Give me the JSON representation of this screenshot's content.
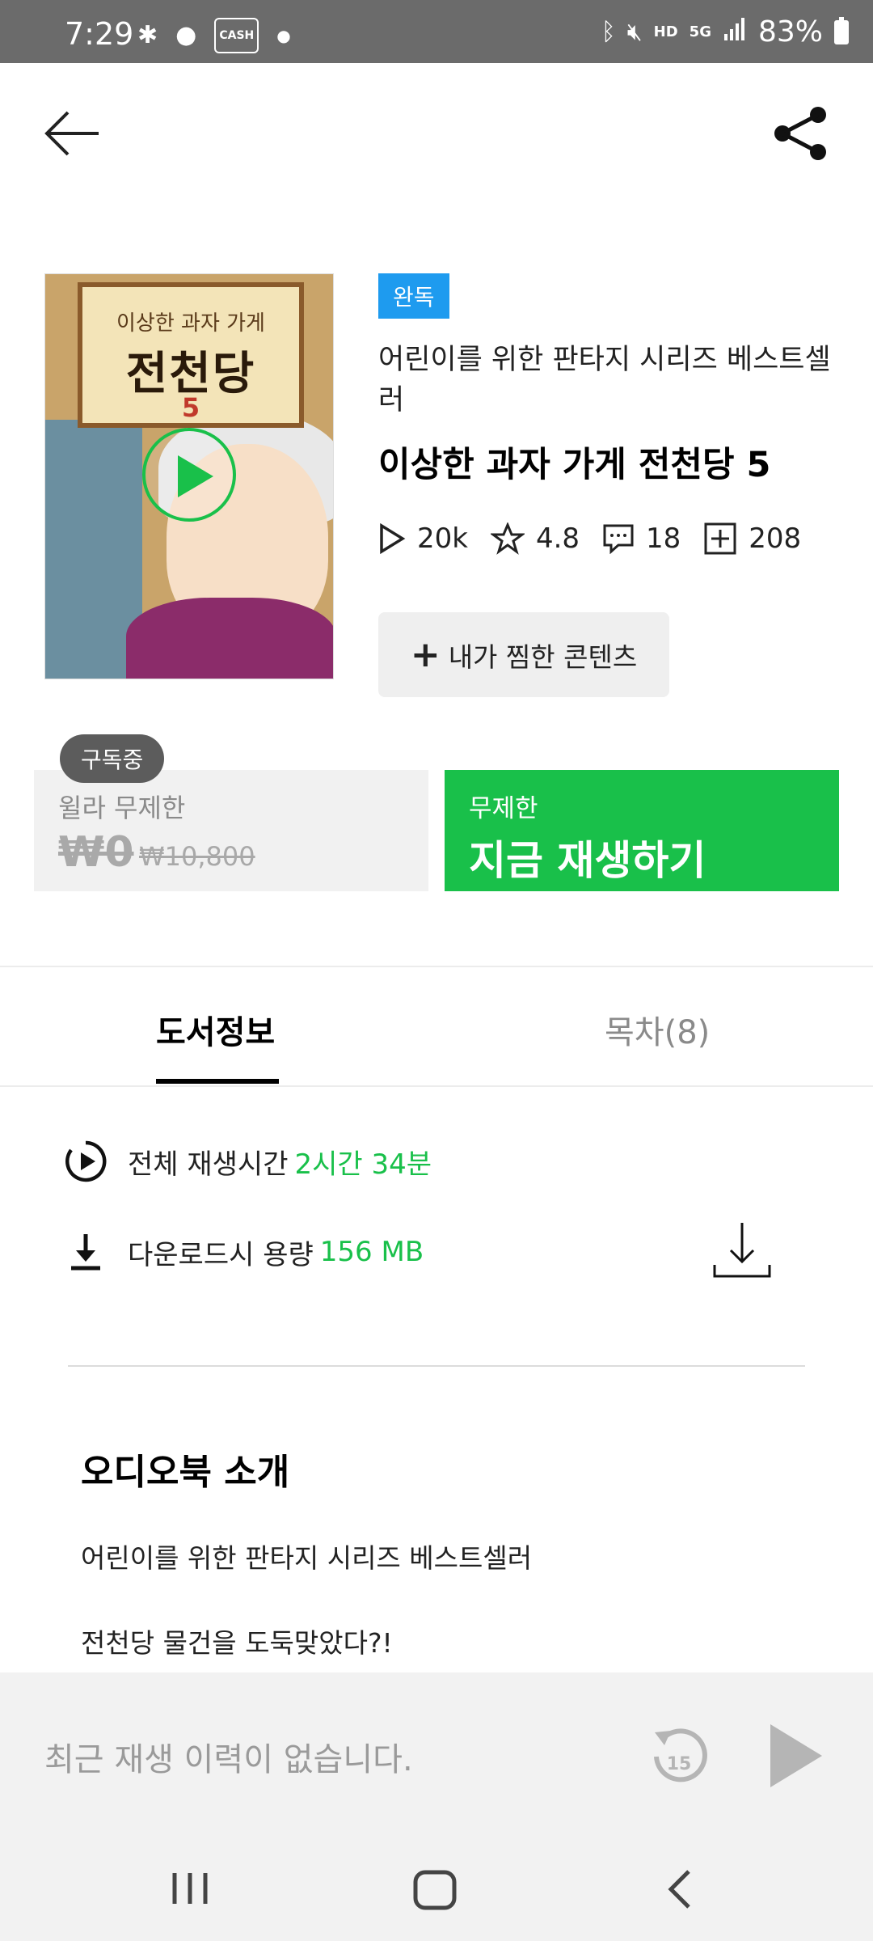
{
  "status_bar": {
    "time": "7:29",
    "battery": "83%",
    "left_icons": [
      "pinwheel-icon",
      "chat-bubble-icon",
      "cash-icon",
      "dot-icon"
    ],
    "cash_label": "CASH",
    "right_icons": [
      "bluetooth-icon",
      "mute-icon",
      "hd-voice-icon",
      "5g-icon",
      "signal-icon",
      "battery-icon"
    ],
    "hd_label": "HD",
    "fiveg_label": "5G"
  },
  "book": {
    "badge": "완독",
    "subtitle": "어린이를 위한 판타지 시리즈 베스트셀러",
    "title": "이상한 과자 가게 전천당 5",
    "cover": {
      "small_title": "이상한 과자 가게",
      "big_title": "전천당",
      "volume": "5"
    },
    "stats": {
      "plays": "20k",
      "rating": "4.8",
      "comments": "18",
      "added": "208"
    },
    "wish_label": "내가 찜한 콘텐츠"
  },
  "purchase": {
    "subscribed_label": "구독중",
    "monthly_label": "윌라 무제한",
    "price_now": "₩0",
    "price_original": "₩10,800",
    "unlimited_label": "무제한",
    "play_now_label": "지금 재생하기"
  },
  "tabs": {
    "info": "도서정보",
    "toc": "목차(8)"
  },
  "details": {
    "total_time_label": "전체 재생시간",
    "total_time_value": "2시간 34분",
    "download_label": "다운로드시 용량",
    "download_value": "156 MB"
  },
  "intro": {
    "heading": "오디오북 소개",
    "line1": "어린이를 위한 판타지 시리즈 베스트셀러",
    "line2": "전천당 물건을 도둑맞았다?!"
  },
  "player": {
    "empty_text": "최근 재생 이력이 없습니다.",
    "rewind_seconds": "15"
  },
  "colors": {
    "accent_green": "#19c04a",
    "badge_blue": "#1e9bef",
    "status_bar": "#6b6b6b"
  }
}
